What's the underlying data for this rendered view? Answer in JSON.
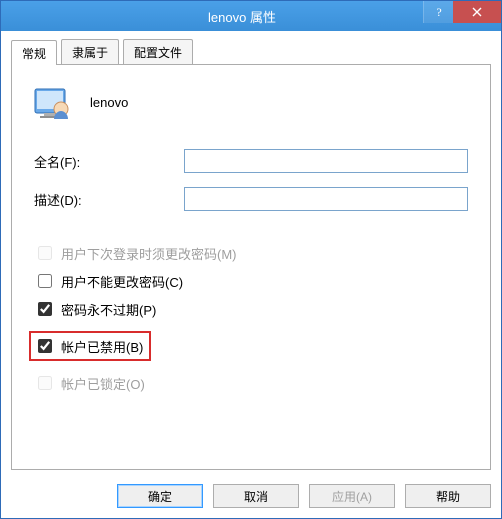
{
  "title": "lenovo 属性",
  "tabs": {
    "general": "常规",
    "member_of": "隶属于",
    "profile": "配置文件"
  },
  "header": {
    "user_name": "lenovo"
  },
  "fields": {
    "full_name_label": "全名(F):",
    "full_name_value": "",
    "description_label": "描述(D):",
    "description_value": ""
  },
  "checkboxes": {
    "must_change": "用户下次登录时须更改密码(M)",
    "cannot_change": "用户不能更改密码(C)",
    "never_expires": "密码永不过期(P)",
    "disabled": "帐户已禁用(B)",
    "locked": "帐户已锁定(O)"
  },
  "buttons": {
    "ok": "确定",
    "cancel": "取消",
    "apply": "应用(A)",
    "help": "帮助"
  }
}
